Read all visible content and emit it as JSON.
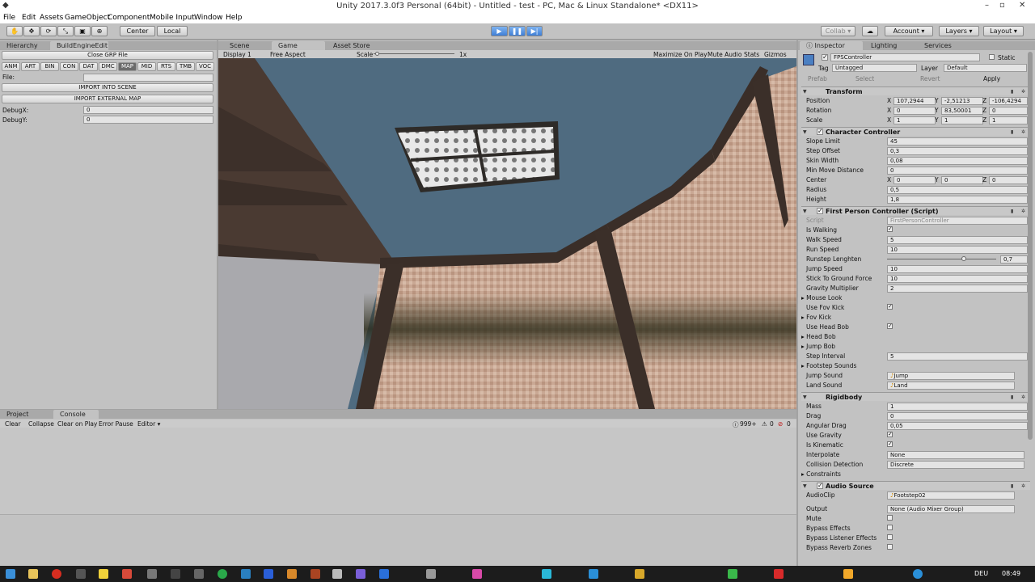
{
  "titlebar": {
    "title": "Unity 2017.3.0f3 Personal (64bit) - Untitled - test - PC, Mac & Linux Standalone* <DX11>"
  },
  "menu": [
    "File",
    "Edit",
    "Assets",
    "GameObject",
    "Component",
    "Mobile Input",
    "Window",
    "Help"
  ],
  "toolbar": {
    "center": "Center",
    "local": "Local",
    "collab": "Collab ▾",
    "account": "Account",
    "layers": "Layers",
    "layout": "Layout"
  },
  "left": {
    "tabs": [
      "Hierarchy",
      "BuildEngineEdit"
    ],
    "close_btn": "Close GRP File",
    "categories": [
      "ANM",
      "ART",
      "BIN",
      "CON",
      "DAT",
      "DMC",
      "MAP",
      "MID",
      "RTS",
      "TMB",
      "VOC"
    ],
    "file_label": "File:",
    "import_scene": "IMPORT INTO SCENE",
    "import_map": "IMPORT EXTERNAL MAP",
    "debugx_label": "DebugX:",
    "debugx": "0",
    "debugy_label": "DebugY:",
    "debugy": "0"
  },
  "game": {
    "tabs": [
      "Scene",
      "Game",
      "Asset Store"
    ],
    "display": "Display 1",
    "aspect": "Free Aspect",
    "scale_label": "Scale",
    "scale_value": "1x",
    "opts": [
      "Maximize On Play",
      "Mute Audio",
      "Stats",
      "Gizmos"
    ]
  },
  "console": {
    "tabs": [
      "Project",
      "Console"
    ],
    "btns": [
      "Clear",
      "Collapse",
      "Clear on Play",
      "Error Pause",
      "Editor ▾"
    ],
    "counts": [
      "999+",
      "0",
      "0"
    ]
  },
  "inspector": {
    "tabs": [
      "Inspector",
      "Lighting",
      "Services"
    ],
    "object_name": "FPSController",
    "static": "Static",
    "tag_label": "Tag",
    "tag": "Untagged",
    "layer_label": "Layer",
    "layer": "Default",
    "prefab": "Prefab",
    "select": "Select",
    "revert": "Revert",
    "apply": "Apply",
    "transform": {
      "title": "Transform",
      "rows": [
        {
          "label": "Position",
          "x": "107,2944",
          "y": "-2,51213",
          "z": "-106,4294"
        },
        {
          "label": "Rotation",
          "x": "0",
          "y": "83,50001",
          "z": "0"
        },
        {
          "label": "Scale",
          "x": "1",
          "y": "1",
          "z": "1"
        }
      ]
    },
    "cc": {
      "title": "Character Controller",
      "rows": [
        [
          "Slope Limit",
          "45"
        ],
        [
          "Step Offset",
          "0,3"
        ],
        [
          "Skin Width",
          "0,08"
        ],
        [
          "Min Move Distance",
          "0"
        ]
      ],
      "center_label": "Center",
      "center": {
        "x": "0",
        "y": "0",
        "z": "0"
      },
      "rows2": [
        [
          "Radius",
          "0,5"
        ],
        [
          "Height",
          "1,8"
        ]
      ]
    },
    "fpc": {
      "title": "First Person Controller (Script)",
      "script_label": "Script",
      "script": "FirstPersonController",
      "is_walking": "Is Walking",
      "walk_speed": "Walk Speed",
      "walk": "5",
      "run_speed": "Run Speed",
      "run": "10",
      "runstep": "Runstep Lenghten",
      "runstep_val": "0,7",
      "runstep_fraction": 0.7,
      "rows": [
        [
          "Jump Speed",
          "10"
        ],
        [
          "Stick To Ground Force",
          "10"
        ],
        [
          "Gravity Multiplier",
          "2"
        ]
      ],
      "mouse_look": "Mouse Look",
      "use_fov": "Use Fov Kick",
      "fov_kick": "Fov Kick",
      "use_head": "Use Head Bob",
      "head_bob": "Head Bob",
      "jump_bob": "Jump Bob",
      "step_interval": "Step Interval",
      "step_val": "5",
      "footstep": "Footstep Sounds",
      "jump_sound": "Jump Sound",
      "jump_clip": "Jump",
      "land_sound": "Land Sound",
      "land_clip": "Land"
    },
    "rb": {
      "title": "Rigidbody",
      "rows": [
        [
          "Mass",
          "1"
        ],
        [
          "Drag",
          "0"
        ],
        [
          "Angular Drag",
          "0,05"
        ]
      ],
      "use_gravity": "Use Gravity",
      "is_kinematic": "Is Kinematic",
      "interp_label": "Interpolate",
      "interp": "None",
      "coll_label": "Collision Detection",
      "coll": "Discrete",
      "constraints": "Constraints"
    },
    "audio": {
      "title": "Audio Source",
      "clip_label": "AudioClip",
      "clip": "Footstep02",
      "output_label": "Output",
      "output": "None (Audio Mixer Group)",
      "checks": [
        "Mute",
        "Bypass Effects",
        "Bypass Listener Effects",
        "Bypass Reverb Zones"
      ]
    }
  },
  "taskbar": {
    "lang": "DEU",
    "time": "08:49"
  },
  "colors": {
    "sky": "#4f6b80",
    "accent": "#3f7fd6",
    "panel": "#c2c2c2"
  }
}
